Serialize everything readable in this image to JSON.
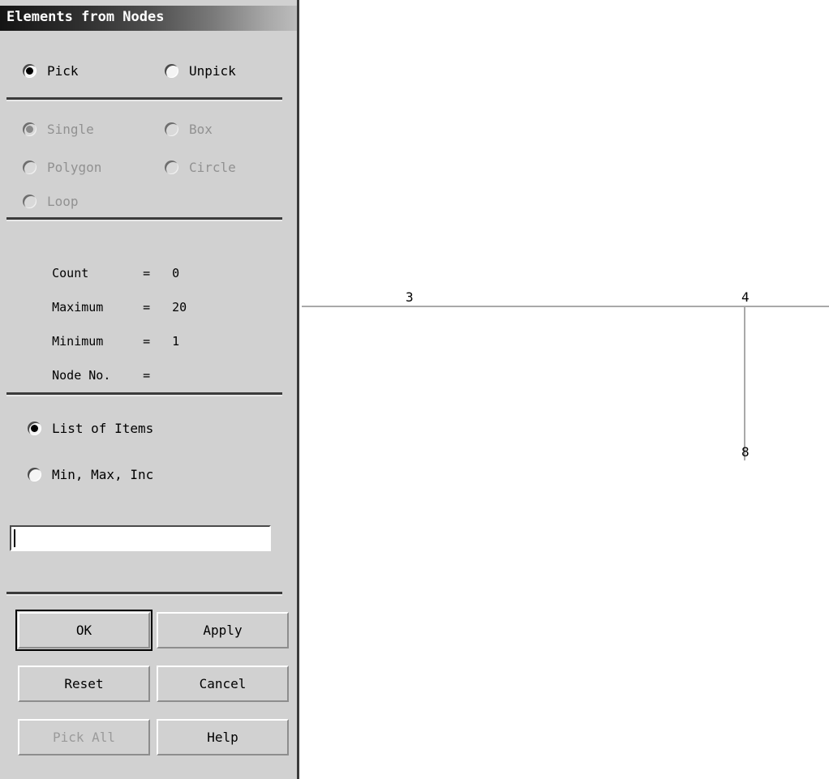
{
  "dialog": {
    "title": "Elements from Nodes",
    "mode": {
      "options": [
        {
          "label": "Pick",
          "selected": true,
          "disabled": false
        },
        {
          "label": "Unpick",
          "selected": false,
          "disabled": false
        }
      ]
    },
    "selection_shape": {
      "options": [
        {
          "label": "Single",
          "selected": true,
          "disabled": true
        },
        {
          "label": "Box",
          "selected": false,
          "disabled": true
        },
        {
          "label": "Polygon",
          "selected": false,
          "disabled": true
        },
        {
          "label": "Circle",
          "selected": false,
          "disabled": true
        },
        {
          "label": "Loop",
          "selected": false,
          "disabled": true
        }
      ]
    },
    "info": [
      {
        "key": "Count",
        "eq": "=",
        "value": "0"
      },
      {
        "key": "Maximum",
        "eq": "=",
        "value": "20"
      },
      {
        "key": "Minimum",
        "eq": "=",
        "value": "1"
      },
      {
        "key": "Node No.",
        "eq": "=",
        "value": ""
      }
    ],
    "entry_mode": {
      "options": [
        {
          "label": "List of Items",
          "selected": true,
          "disabled": false
        },
        {
          "label": "Min, Max, Inc",
          "selected": false,
          "disabled": false
        }
      ]
    },
    "text_entry": {
      "value": "",
      "placeholder": ""
    },
    "buttons": [
      {
        "label": "OK",
        "default": true,
        "disabled": false
      },
      {
        "label": "Apply",
        "default": false,
        "disabled": false
      },
      {
        "label": "Reset",
        "default": false,
        "disabled": false
      },
      {
        "label": "Cancel",
        "default": false,
        "disabled": false
      },
      {
        "label": "Pick All",
        "default": false,
        "disabled": true
      },
      {
        "label": "Help",
        "default": false,
        "disabled": false
      }
    ]
  },
  "graphics": {
    "node_labels": [
      {
        "text": "3"
      },
      {
        "text": "4"
      },
      {
        "text": "8"
      }
    ]
  },
  "colors": {
    "panel_background": "#d1d1d1",
    "mesh_line": "#a9a9a9",
    "canvas_background": "#ffffff",
    "separator": "#3b3b3b",
    "disabled_text": "#919191"
  }
}
